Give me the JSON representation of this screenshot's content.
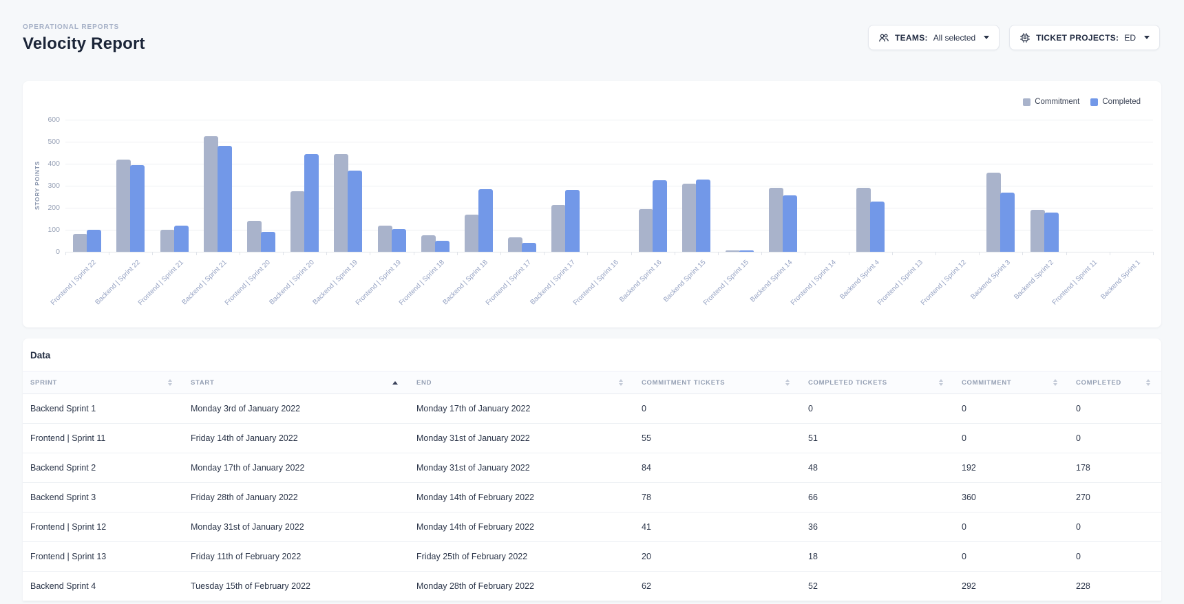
{
  "page": {
    "breadcrumb": "OPERATIONAL REPORTS",
    "title": "Velocity Report"
  },
  "filters": {
    "teams": {
      "icon": "people-icon",
      "label": "TEAMS:",
      "value": "All selected"
    },
    "ticket_projects": {
      "icon": "chip-icon",
      "label": "TICKET PROJECTS:",
      "value": "ED"
    }
  },
  "chart_data": {
    "type": "bar",
    "title": "",
    "xlabel": "",
    "ylabel": "STORY POINTS",
    "ylim": [
      0,
      600
    ],
    "yticks": [
      0,
      100,
      200,
      300,
      400,
      500,
      600
    ],
    "grid": true,
    "legend_position": "top-right",
    "categories": [
      "Frontend | Sprint 22",
      "Backend | Sprint 22",
      "Frontend | Sprint 21",
      "Backend | Sprint 21",
      "Frontend | Sprint 20",
      "Backend | Sprint 20",
      "Backend | Sprint 19",
      "Frontend | Sprint 19",
      "Frontend | Sprint 18",
      "Backend | Sprint 18",
      "Frontend | Sprint 17",
      "Backend | Sprint 17",
      "Frontend | Sprint 16",
      "Backend Sprint 16",
      "Backend Sprint 15",
      "Frontend | Sprint 15",
      "Backend Sprint 14",
      "Frontend | Sprint 14",
      "Backend Sprint 4",
      "Frontend | Sprint 13",
      "Frontend | Sprint 12",
      "Backend Sprint 3",
      "Backend Sprint 2",
      "Frontend | Sprint 11",
      "Backend Sprint 1"
    ],
    "series": [
      {
        "name": "Commitment",
        "color": "#A9B3CB",
        "values": [
          80,
          420,
          100,
          525,
          140,
          275,
          445,
          120,
          75,
          170,
          65,
          212,
          0,
          195,
          310,
          2,
          290,
          0,
          292,
          0,
          0,
          360,
          192,
          0,
          0
        ]
      },
      {
        "name": "Completed",
        "color": "#7298E8",
        "values": [
          100,
          395,
          120,
          482,
          92,
          445,
          370,
          102,
          50,
          285,
          42,
          280,
          0,
          325,
          328,
          6,
          255,
          0,
          228,
          0,
          0,
          270,
          178,
          0,
          0
        ]
      }
    ]
  },
  "table": {
    "title": "Data",
    "columns": [
      {
        "label": "SPRINT",
        "sort": "none"
      },
      {
        "label": "START",
        "sort": "asc"
      },
      {
        "label": "END",
        "sort": "none"
      },
      {
        "label": "COMMITMENT TICKETS",
        "sort": "none"
      },
      {
        "label": "COMPLETED TICKETS",
        "sort": "none"
      },
      {
        "label": "COMMITMENT",
        "sort": "none"
      },
      {
        "label": "COMPLETED",
        "sort": "none"
      }
    ],
    "rows": [
      [
        "Backend Sprint 1",
        "Monday 3rd of January 2022",
        "Monday 17th of January 2022",
        "0",
        "0",
        "0",
        "0"
      ],
      [
        "Frontend | Sprint 11",
        "Friday 14th of January 2022",
        "Monday 31st of January 2022",
        "55",
        "51",
        "0",
        "0"
      ],
      [
        "Backend Sprint 2",
        "Monday 17th of January 2022",
        "Monday 31st of January 2022",
        "84",
        "48",
        "192",
        "178"
      ],
      [
        "Backend Sprint 3",
        "Friday 28th of January 2022",
        "Monday 14th of February 2022",
        "78",
        "66",
        "360",
        "270"
      ],
      [
        "Frontend | Sprint 12",
        "Monday 31st of January 2022",
        "Monday 14th of February 2022",
        "41",
        "36",
        "0",
        "0"
      ],
      [
        "Frontend | Sprint 13",
        "Friday 11th of February 2022",
        "Friday 25th of February 2022",
        "20",
        "18",
        "0",
        "0"
      ],
      [
        "Backend Sprint 4",
        "Tuesday 15th of February 2022",
        "Monday 28th of February 2022",
        "62",
        "52",
        "292",
        "228"
      ]
    ]
  }
}
